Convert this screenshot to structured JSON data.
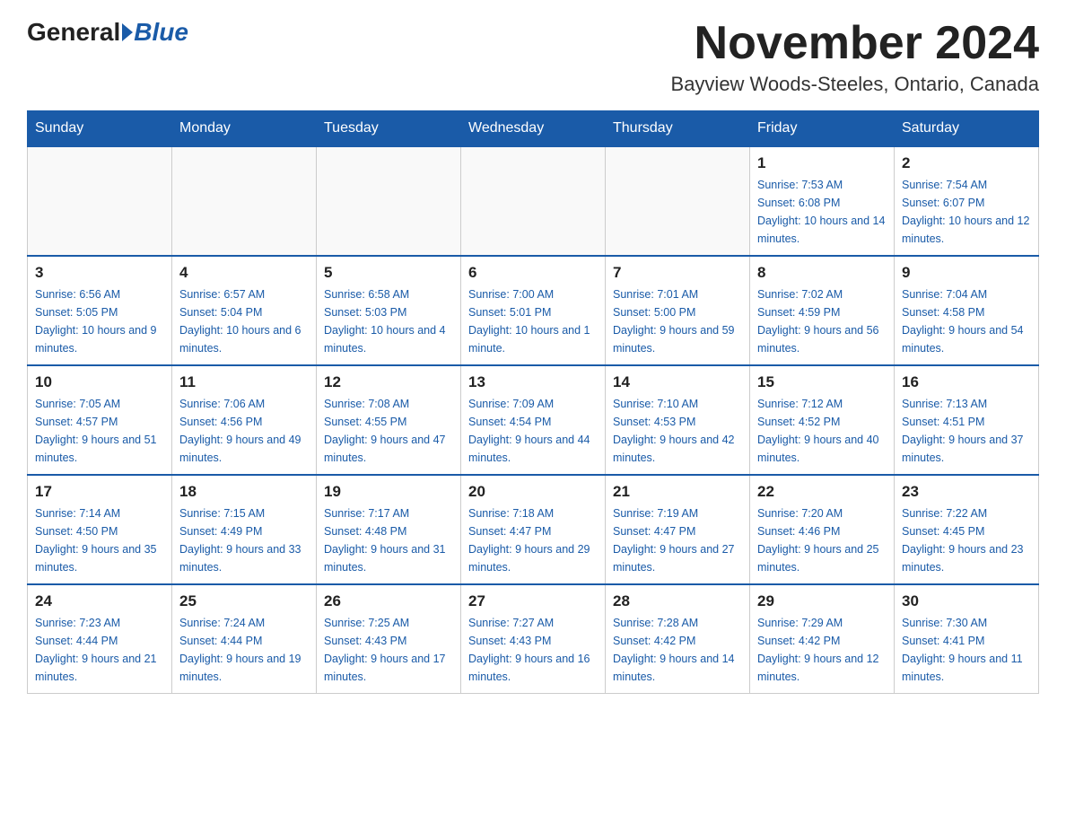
{
  "logo": {
    "text_general": "General",
    "text_blue": "Blue"
  },
  "title": "November 2024",
  "subtitle": "Bayview Woods-Steeles, Ontario, Canada",
  "weekdays": [
    "Sunday",
    "Monday",
    "Tuesday",
    "Wednesday",
    "Thursday",
    "Friday",
    "Saturday"
  ],
  "weeks": [
    [
      {
        "day": "",
        "sunrise": "",
        "sunset": "",
        "daylight": ""
      },
      {
        "day": "",
        "sunrise": "",
        "sunset": "",
        "daylight": ""
      },
      {
        "day": "",
        "sunrise": "",
        "sunset": "",
        "daylight": ""
      },
      {
        "day": "",
        "sunrise": "",
        "sunset": "",
        "daylight": ""
      },
      {
        "day": "",
        "sunrise": "",
        "sunset": "",
        "daylight": ""
      },
      {
        "day": "1",
        "sunrise": "Sunrise: 7:53 AM",
        "sunset": "Sunset: 6:08 PM",
        "daylight": "Daylight: 10 hours and 14 minutes."
      },
      {
        "day": "2",
        "sunrise": "Sunrise: 7:54 AM",
        "sunset": "Sunset: 6:07 PM",
        "daylight": "Daylight: 10 hours and 12 minutes."
      }
    ],
    [
      {
        "day": "3",
        "sunrise": "Sunrise: 6:56 AM",
        "sunset": "Sunset: 5:05 PM",
        "daylight": "Daylight: 10 hours and 9 minutes."
      },
      {
        "day": "4",
        "sunrise": "Sunrise: 6:57 AM",
        "sunset": "Sunset: 5:04 PM",
        "daylight": "Daylight: 10 hours and 6 minutes."
      },
      {
        "day": "5",
        "sunrise": "Sunrise: 6:58 AM",
        "sunset": "Sunset: 5:03 PM",
        "daylight": "Daylight: 10 hours and 4 minutes."
      },
      {
        "day": "6",
        "sunrise": "Sunrise: 7:00 AM",
        "sunset": "Sunset: 5:01 PM",
        "daylight": "Daylight: 10 hours and 1 minute."
      },
      {
        "day": "7",
        "sunrise": "Sunrise: 7:01 AM",
        "sunset": "Sunset: 5:00 PM",
        "daylight": "Daylight: 9 hours and 59 minutes."
      },
      {
        "day": "8",
        "sunrise": "Sunrise: 7:02 AM",
        "sunset": "Sunset: 4:59 PM",
        "daylight": "Daylight: 9 hours and 56 minutes."
      },
      {
        "day": "9",
        "sunrise": "Sunrise: 7:04 AM",
        "sunset": "Sunset: 4:58 PM",
        "daylight": "Daylight: 9 hours and 54 minutes."
      }
    ],
    [
      {
        "day": "10",
        "sunrise": "Sunrise: 7:05 AM",
        "sunset": "Sunset: 4:57 PM",
        "daylight": "Daylight: 9 hours and 51 minutes."
      },
      {
        "day": "11",
        "sunrise": "Sunrise: 7:06 AM",
        "sunset": "Sunset: 4:56 PM",
        "daylight": "Daylight: 9 hours and 49 minutes."
      },
      {
        "day": "12",
        "sunrise": "Sunrise: 7:08 AM",
        "sunset": "Sunset: 4:55 PM",
        "daylight": "Daylight: 9 hours and 47 minutes."
      },
      {
        "day": "13",
        "sunrise": "Sunrise: 7:09 AM",
        "sunset": "Sunset: 4:54 PM",
        "daylight": "Daylight: 9 hours and 44 minutes."
      },
      {
        "day": "14",
        "sunrise": "Sunrise: 7:10 AM",
        "sunset": "Sunset: 4:53 PM",
        "daylight": "Daylight: 9 hours and 42 minutes."
      },
      {
        "day": "15",
        "sunrise": "Sunrise: 7:12 AM",
        "sunset": "Sunset: 4:52 PM",
        "daylight": "Daylight: 9 hours and 40 minutes."
      },
      {
        "day": "16",
        "sunrise": "Sunrise: 7:13 AM",
        "sunset": "Sunset: 4:51 PM",
        "daylight": "Daylight: 9 hours and 37 minutes."
      }
    ],
    [
      {
        "day": "17",
        "sunrise": "Sunrise: 7:14 AM",
        "sunset": "Sunset: 4:50 PM",
        "daylight": "Daylight: 9 hours and 35 minutes."
      },
      {
        "day": "18",
        "sunrise": "Sunrise: 7:15 AM",
        "sunset": "Sunset: 4:49 PM",
        "daylight": "Daylight: 9 hours and 33 minutes."
      },
      {
        "day": "19",
        "sunrise": "Sunrise: 7:17 AM",
        "sunset": "Sunset: 4:48 PM",
        "daylight": "Daylight: 9 hours and 31 minutes."
      },
      {
        "day": "20",
        "sunrise": "Sunrise: 7:18 AM",
        "sunset": "Sunset: 4:47 PM",
        "daylight": "Daylight: 9 hours and 29 minutes."
      },
      {
        "day": "21",
        "sunrise": "Sunrise: 7:19 AM",
        "sunset": "Sunset: 4:47 PM",
        "daylight": "Daylight: 9 hours and 27 minutes."
      },
      {
        "day": "22",
        "sunrise": "Sunrise: 7:20 AM",
        "sunset": "Sunset: 4:46 PM",
        "daylight": "Daylight: 9 hours and 25 minutes."
      },
      {
        "day": "23",
        "sunrise": "Sunrise: 7:22 AM",
        "sunset": "Sunset: 4:45 PM",
        "daylight": "Daylight: 9 hours and 23 minutes."
      }
    ],
    [
      {
        "day": "24",
        "sunrise": "Sunrise: 7:23 AM",
        "sunset": "Sunset: 4:44 PM",
        "daylight": "Daylight: 9 hours and 21 minutes."
      },
      {
        "day": "25",
        "sunrise": "Sunrise: 7:24 AM",
        "sunset": "Sunset: 4:44 PM",
        "daylight": "Daylight: 9 hours and 19 minutes."
      },
      {
        "day": "26",
        "sunrise": "Sunrise: 7:25 AM",
        "sunset": "Sunset: 4:43 PM",
        "daylight": "Daylight: 9 hours and 17 minutes."
      },
      {
        "day": "27",
        "sunrise": "Sunrise: 7:27 AM",
        "sunset": "Sunset: 4:43 PM",
        "daylight": "Daylight: 9 hours and 16 minutes."
      },
      {
        "day": "28",
        "sunrise": "Sunrise: 7:28 AM",
        "sunset": "Sunset: 4:42 PM",
        "daylight": "Daylight: 9 hours and 14 minutes."
      },
      {
        "day": "29",
        "sunrise": "Sunrise: 7:29 AM",
        "sunset": "Sunset: 4:42 PM",
        "daylight": "Daylight: 9 hours and 12 minutes."
      },
      {
        "day": "30",
        "sunrise": "Sunrise: 7:30 AM",
        "sunset": "Sunset: 4:41 PM",
        "daylight": "Daylight: 9 hours and 11 minutes."
      }
    ]
  ]
}
